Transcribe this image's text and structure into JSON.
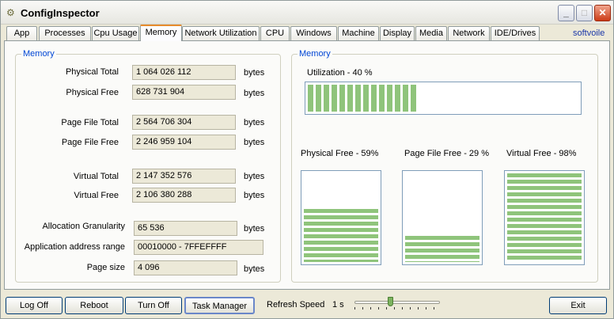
{
  "app": {
    "title": "ConfigInspector",
    "icon": "wrench-gear-icon"
  },
  "tabs": [
    "App",
    "Processes",
    "Cpu Usage",
    "Memory",
    "Network Utilization",
    "CPU",
    "Windows",
    "Machine",
    "Display",
    "Media",
    "Network",
    "IDE/Drives"
  ],
  "active_tab": "Memory",
  "brand": "softvoile",
  "memory_left": {
    "group_label": "Memory",
    "rows": [
      {
        "label": "Physical Total",
        "value": "1 064 026 112",
        "unit": "bytes"
      },
      {
        "label": "Physical Free",
        "value": "628 731 904",
        "unit": "bytes"
      },
      {
        "label": "Page File Total",
        "value": "2 564 706 304",
        "unit": "bytes"
      },
      {
        "label": "Page File Free",
        "value": "2 246 959 104",
        "unit": "bytes"
      },
      {
        "label": "Virtual Total",
        "value": "2 147 352 576",
        "unit": "bytes"
      },
      {
        "label": "Virtual Free",
        "value": "2 106 380 288",
        "unit": "bytes"
      },
      {
        "label": "Allocation Granularity",
        "value": "65 536",
        "unit": "bytes"
      },
      {
        "label": "Application address range",
        "value": "00010000 - 7FFEFFFF",
        "unit": ""
      },
      {
        "label": "Page size",
        "value": "4 096",
        "unit": "bytes"
      }
    ]
  },
  "memory_right": {
    "group_label": "Memory",
    "utilization_label": "Utilization -  40 %",
    "utilization_fraction": 0.4,
    "bars": [
      {
        "label": "Physical Free - 59%",
        "fraction": 0.59
      },
      {
        "label": "Page File Free - 29 %",
        "fraction": 0.29
      },
      {
        "label": "Virtual Free -  98%",
        "fraction": 0.98
      }
    ]
  },
  "bottom": {
    "buttons": [
      "Log Off",
      "Reboot",
      "Turn Off",
      "Task Manager"
    ],
    "refresh_label": "Refresh Speed",
    "refresh_value": "1 s",
    "refresh_slider_fraction": 0.42,
    "exit_label": "Exit"
  },
  "colors": {
    "bar_fill": "#8fc47b",
    "group_label": "#0046d5",
    "brand": "#1c38a8",
    "active_tab_accent": "#e68b2c"
  }
}
